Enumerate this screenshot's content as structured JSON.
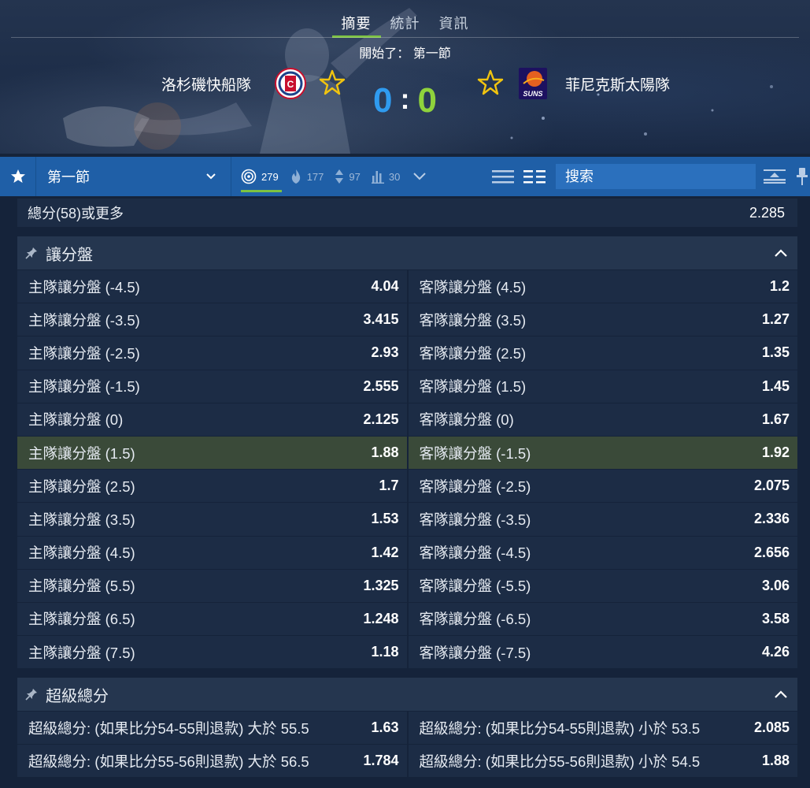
{
  "tabs": [
    {
      "label": "摘要",
      "active": true
    },
    {
      "label": "統計",
      "active": false
    },
    {
      "label": "資訊",
      "active": false
    }
  ],
  "status": "開始了： 第一節",
  "home_team": {
    "name": "洛杉磯快船隊",
    "score": "0",
    "logo_icon": "clippers-logo"
  },
  "away_team": {
    "name": "菲尼克斯太陽隊",
    "score": "0",
    "logo_icon": "suns-logo",
    "logo_text": "SUNS"
  },
  "score_separator": ":",
  "colors": {
    "home_score": "#2f9bf0",
    "away_score": "#8fd33c",
    "accent": "#7cc242",
    "toolbar": "#1f5fa7",
    "highlight_row": "#3a4a39"
  },
  "toolbar": {
    "period_label": "第一節",
    "counts": [
      {
        "icon": "target-icon",
        "value": "279",
        "active": true
      },
      {
        "icon": "flame-icon",
        "value": "177",
        "active": false
      },
      {
        "icon": "updown-arrows-icon",
        "value": "97",
        "active": false
      },
      {
        "icon": "bar-chart-icon",
        "value": "30",
        "active": false
      }
    ],
    "search_placeholder": "搜索"
  },
  "total_row": {
    "label": "總分(58)或更多",
    "odds": "2.285"
  },
  "handicap": {
    "title": "讓分盤",
    "rows": [
      {
        "home_label": "主隊讓分盤 (-4.5)",
        "home_odds": "4.04",
        "away_label": "客隊讓分盤 (4.5)",
        "away_odds": "1.2"
      },
      {
        "home_label": "主隊讓分盤 (-3.5)",
        "home_odds": "3.415",
        "away_label": "客隊讓分盤 (3.5)",
        "away_odds": "1.27"
      },
      {
        "home_label": "主隊讓分盤 (-2.5)",
        "home_odds": "2.93",
        "away_label": "客隊讓分盤 (2.5)",
        "away_odds": "1.35"
      },
      {
        "home_label": "主隊讓分盤 (-1.5)",
        "home_odds": "2.555",
        "away_label": "客隊讓分盤 (1.5)",
        "away_odds": "1.45"
      },
      {
        "home_label": "主隊讓分盤 (0)",
        "home_odds": "2.125",
        "away_label": "客隊讓分盤 (0)",
        "away_odds": "1.67"
      },
      {
        "home_label": "主隊讓分盤 (1.5)",
        "home_odds": "1.88",
        "away_label": "客隊讓分盤 (-1.5)",
        "away_odds": "1.92"
      },
      {
        "home_label": "主隊讓分盤 (2.5)",
        "home_odds": "1.7",
        "away_label": "客隊讓分盤 (-2.5)",
        "away_odds": "2.075"
      },
      {
        "home_label": "主隊讓分盤 (3.5)",
        "home_odds": "1.53",
        "away_label": "客隊讓分盤 (-3.5)",
        "away_odds": "2.336"
      },
      {
        "home_label": "主隊讓分盤 (4.5)",
        "home_odds": "1.42",
        "away_label": "客隊讓分盤 (-4.5)",
        "away_odds": "2.656"
      },
      {
        "home_label": "主隊讓分盤 (5.5)",
        "home_odds": "1.325",
        "away_label": "客隊讓分盤 (-5.5)",
        "away_odds": "3.06"
      },
      {
        "home_label": "主隊讓分盤 (6.5)",
        "home_odds": "1.248",
        "away_label": "客隊讓分盤 (-6.5)",
        "away_odds": "3.58"
      },
      {
        "home_label": "主隊讓分盤 (7.5)",
        "home_odds": "1.18",
        "away_label": "客隊讓分盤 (-7.5)",
        "away_odds": "4.26"
      }
    ]
  },
  "super_total": {
    "title": "超級總分",
    "rows": [
      {
        "home_label": "超級總分: (如果比分54-55則退款) 大於 55.5",
        "home_odds": "1.63",
        "away_label": "超級總分: (如果比分54-55則退款) 小於 53.5",
        "away_odds": "2.085"
      },
      {
        "home_label": "超級總分: (如果比分55-56則退款) 大於 56.5",
        "home_odds": "1.784",
        "away_label": "超級總分: (如果比分55-56則退款) 小於 54.5",
        "away_odds": "1.88"
      }
    ]
  }
}
